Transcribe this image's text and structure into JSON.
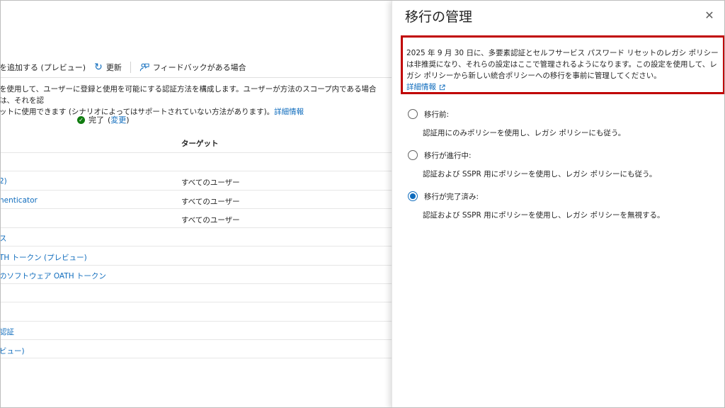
{
  "toolbar": {
    "add_label": "を追加する (プレビュー)",
    "refresh_label": "更新",
    "feedback_label": "フィードバックがある場合"
  },
  "description": {
    "line1": "を使用して、ユーザーに登録と使用を可能にする認証方法を構成します。ユーザーが方法のスコープ内である場合は、それを認",
    "line2": "ットに使用できます (シナリオによってはサポートされていない方法があります)。",
    "learn_more": "詳細情報"
  },
  "status": {
    "label": "完了",
    "open_paren": "(",
    "change_link": "変更",
    "close_paren": ")"
  },
  "table": {
    "target_header": "ターゲット",
    "rows": [
      {
        "method": "",
        "target": ""
      },
      {
        "method": "2)",
        "target": "すべてのユーザー"
      },
      {
        "method": "henticator",
        "target": "すべてのユーザー"
      },
      {
        "method": "",
        "target": "すべてのユーザー"
      },
      {
        "method": "ス",
        "target": ""
      },
      {
        "method": "TH トークン (プレビュー)",
        "target": ""
      },
      {
        "method": "のソフトウェア OATH トークン",
        "target": ""
      },
      {
        "method": "",
        "target": ""
      },
      {
        "method": "",
        "target": ""
      },
      {
        "method": "認証",
        "target": ""
      },
      {
        "method": "ビュー)",
        "target": ""
      }
    ]
  },
  "panel": {
    "title": "移行の管理",
    "notice_line1": "2025 年 9 月 30 日に、多要素認証とセルフサービス パスワード リセットのレガシ ポリシー",
    "notice_line2": "は非推奨になり、それらの設定はここで管理されるようになります。この設定を使用して、レ",
    "notice_line3": "ガシ ポリシーから新しい統合ポリシーへの移行を事前に管理してください。",
    "learn_more": "詳細情報",
    "options": [
      {
        "label": "移行前:",
        "description": "認証用にのみポリシーを使用し、レガシ ポリシーにも従う。",
        "selected": false
      },
      {
        "label": "移行が進行中:",
        "description": "認証および SSPR 用にポリシーを使用し、レガシ ポリシーにも従う。",
        "selected": false
      },
      {
        "label": "移行が完了済み:",
        "description": "認証および SSPR 用にポリシーを使用し、レガシ ポリシーを無視する。",
        "selected": true
      }
    ]
  },
  "colors": {
    "accent": "#0f6cbd",
    "highlight_border": "#c00000",
    "success": "#107c10"
  }
}
